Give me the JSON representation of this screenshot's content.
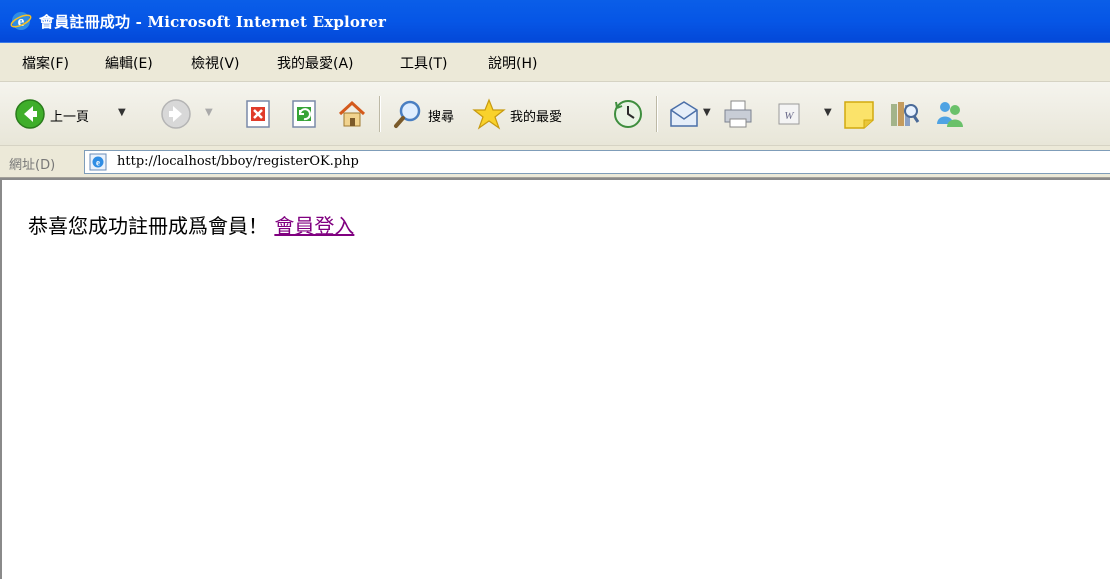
{
  "window": {
    "title": "會員註冊成功 - Microsoft Internet Explorer"
  },
  "menu": {
    "items": [
      "檔案(F)",
      "編輯(E)",
      "檢視(V)",
      "我的最愛(A)",
      "工具(T)",
      "說明(H)"
    ]
  },
  "toolbar": {
    "back_label": "上一頁",
    "search_label": "搜尋",
    "favorites_label": "我的最愛"
  },
  "address": {
    "label": "網址(D)",
    "url": "http://localhost/bboy/registerOK.php"
  },
  "content": {
    "message": "恭喜您成功註冊成爲會員！",
    "link_text": "會員登入"
  },
  "colors": {
    "titlebar": "#0656e6",
    "chrome": "#ece9d8",
    "link_visited": "#800080"
  }
}
